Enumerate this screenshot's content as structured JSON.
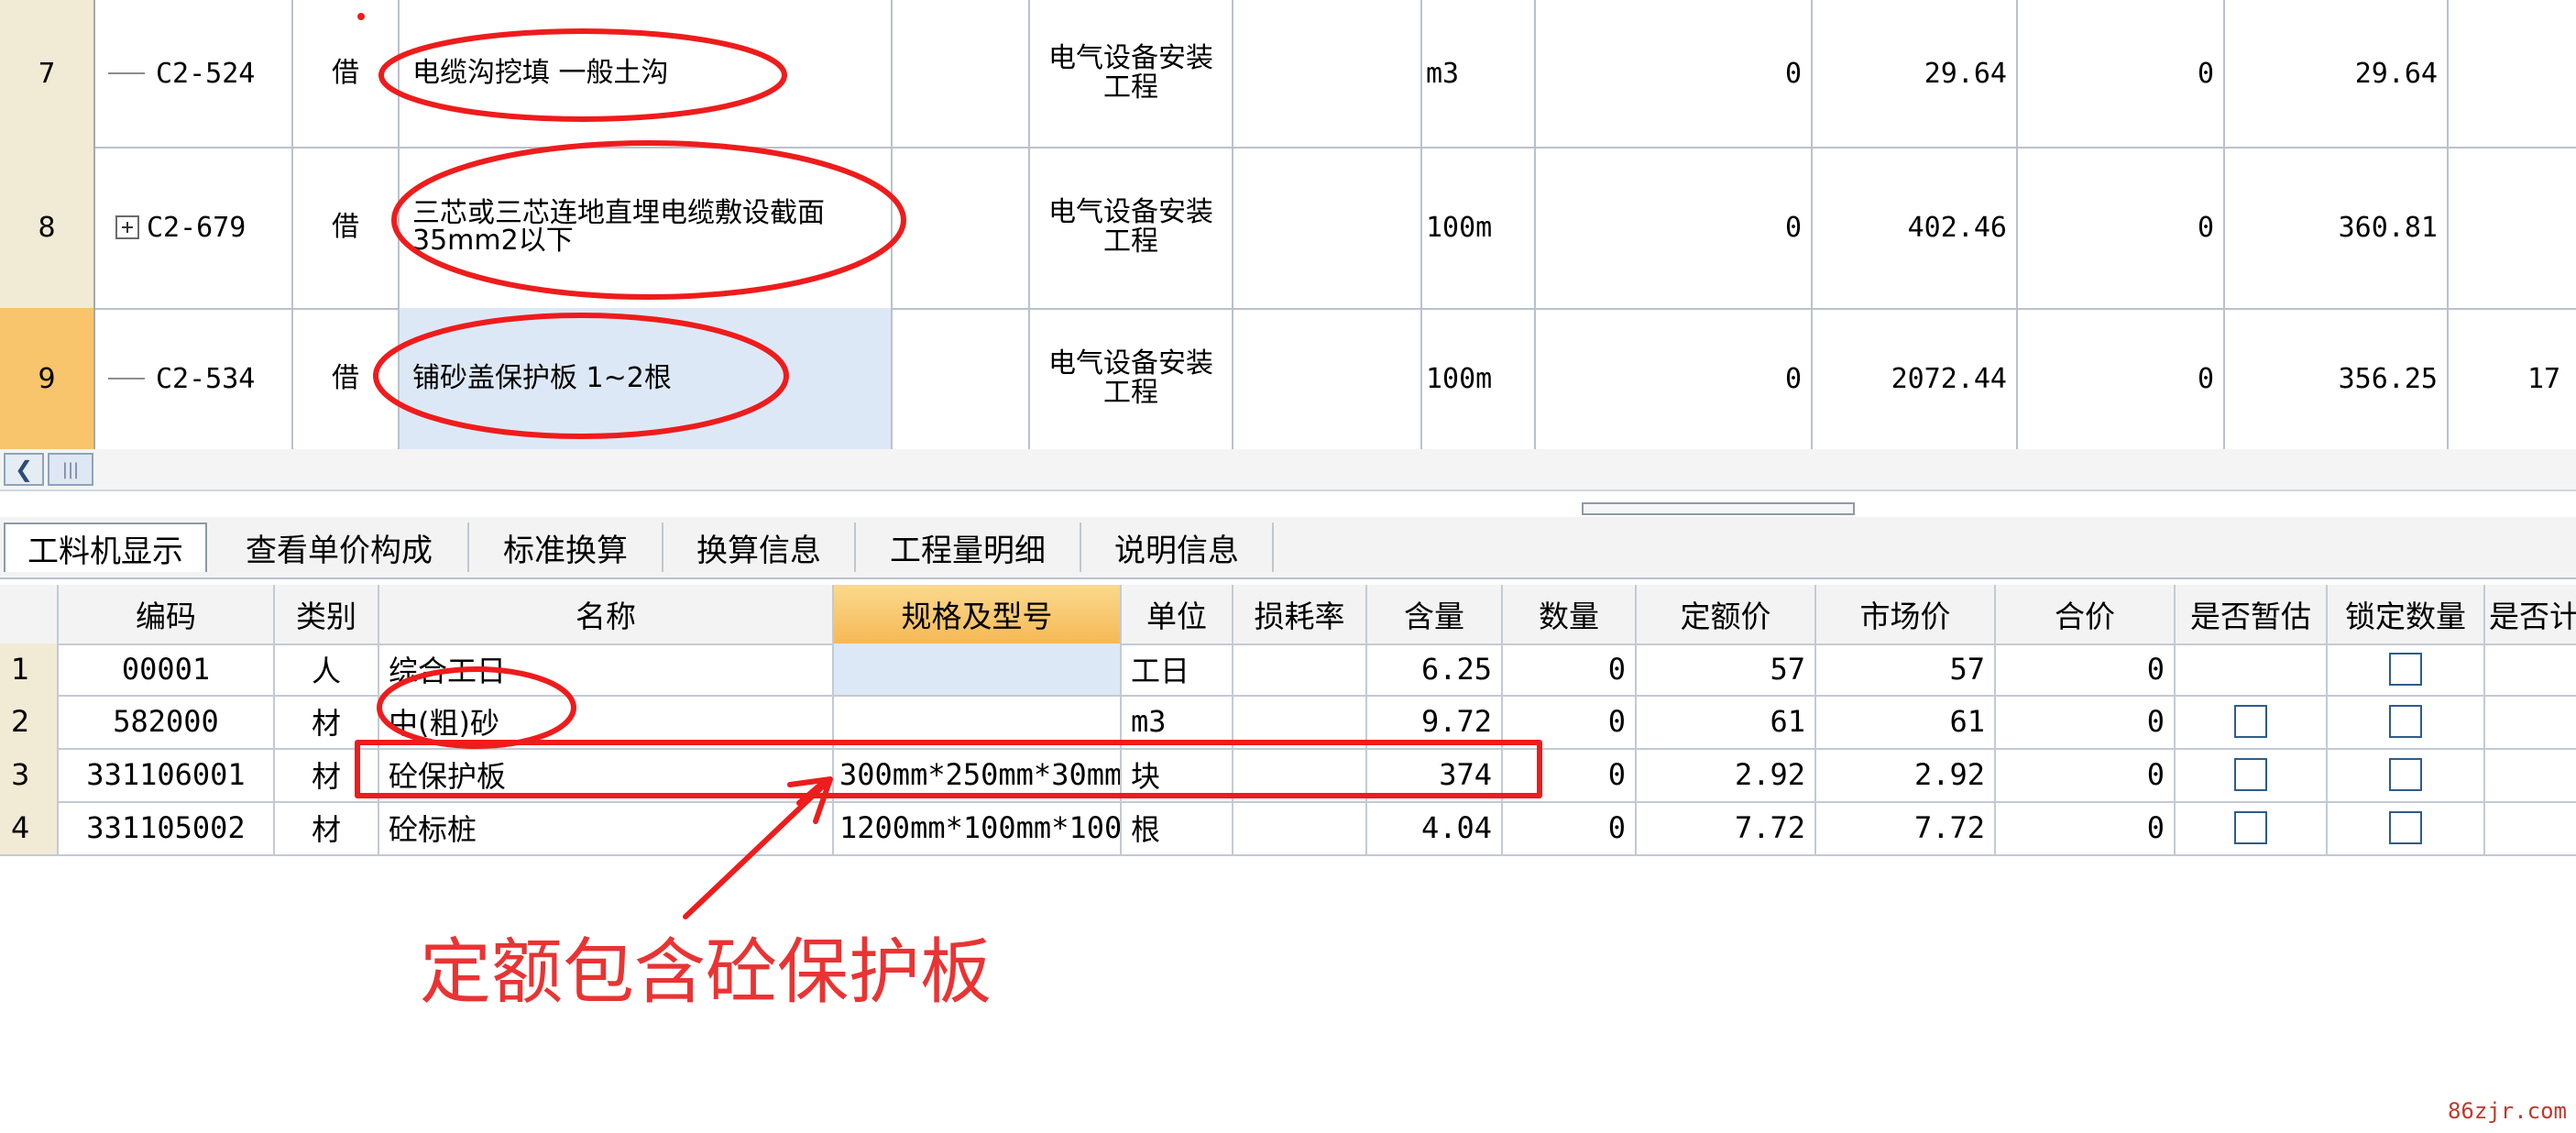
{
  "top_grid": {
    "rows": [
      {
        "num": "7",
        "code": "C2-524",
        "type": "借",
        "desc": "电缆沟挖填 一般土沟",
        "category": "电气设备安装工程",
        "unit": "m3",
        "qty": "0",
        "unit_price": "29.64",
        "total": "0",
        "market": "29.64",
        "extra": "",
        "expand": false,
        "selected": false
      },
      {
        "num": "8",
        "code": "C2-679",
        "type": "借",
        "desc": "三芯或三芯连地直埋电缆敷设截面35mm2以下",
        "category": "电气设备安装工程",
        "unit": "100m",
        "qty": "0",
        "unit_price": "402.46",
        "total": "0",
        "market": "360.81",
        "extra": "",
        "expand": true,
        "selected": false
      },
      {
        "num": "9",
        "code": "C2-534",
        "type": "借",
        "desc": "铺砂盖保护板 1~2根",
        "category": "电气设备安装工程",
        "unit": "100m",
        "qty": "0",
        "unit_price": "2072.44",
        "total": "0",
        "market": "356.25",
        "extra": "17",
        "expand": false,
        "selected": true
      }
    ]
  },
  "scrollbar": {
    "left_icon": "chevron-left-icon",
    "thumb_icon": "grip-icon"
  },
  "tabs": [
    {
      "label": "工料机显示",
      "active": true
    },
    {
      "label": "查看单价构成",
      "active": false
    },
    {
      "label": "标准换算",
      "active": false
    },
    {
      "label": "换算信息",
      "active": false
    },
    {
      "label": "工程量明细",
      "active": false
    },
    {
      "label": "说明信息",
      "active": false
    }
  ],
  "bottom_grid": {
    "headers": [
      "编码",
      "类别",
      "名称",
      "规格及型号",
      "单位",
      "损耗率",
      "含量",
      "数量",
      "定额价",
      "市场价",
      "合价",
      "是否暂估",
      "锁定数量",
      "是否计"
    ],
    "rows": [
      {
        "num": "1",
        "code": "00001",
        "type": "人",
        "name": "综合工日",
        "spec": "",
        "unit": "工日",
        "loss": "",
        "content": "6.25",
        "qty": "0",
        "quota_price": "57",
        "market": "57",
        "total": "0",
        "est_checkbox": false,
        "lock_checkbox": true
      },
      {
        "num": "2",
        "code": "582000",
        "type": "材",
        "name": "中(粗)砂",
        "spec": "",
        "unit": "m3",
        "loss": "",
        "content": "9.72",
        "qty": "0",
        "quota_price": "61",
        "market": "61",
        "total": "0",
        "est_checkbox": true,
        "lock_checkbox": true
      },
      {
        "num": "3",
        "code": "331106001",
        "type": "材",
        "name": "砼保护板",
        "spec": "300mm*250mm*30mm",
        "unit": "块",
        "loss": "",
        "content": "374",
        "qty": "0",
        "quota_price": "2.92",
        "market": "2.92",
        "total": "0",
        "est_checkbox": true,
        "lock_checkbox": true
      },
      {
        "num": "4",
        "code": "331105002",
        "type": "材",
        "name": "砼标桩",
        "spec": "1200mm*100mm*100",
        "unit": "根",
        "loss": "",
        "content": "4.04",
        "qty": "0",
        "quota_price": "7.72",
        "market": "7.72",
        "total": "0",
        "est_checkbox": true,
        "lock_checkbox": true
      }
    ]
  },
  "annotation": {
    "text": "定额包含砼保护板",
    "color": "#ea3333"
  },
  "watermark": "86zjr.com",
  "colors": {
    "row_header": "#f1ead5",
    "selected_row": "#f8c46c",
    "selected_cell": "#dde8f6",
    "highlight_header": "#f5b955",
    "checkbox_border": "#2d5c8c"
  }
}
